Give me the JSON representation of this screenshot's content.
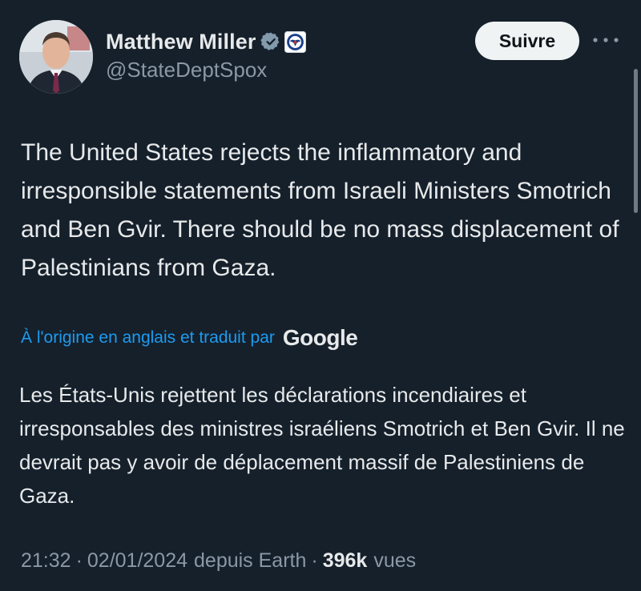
{
  "author": {
    "display_name": "Matthew Miller",
    "handle": "@StateDeptSpox",
    "verified_icon": "gray-verified-badge-icon",
    "affiliation_icon": "us-state-department-seal-icon"
  },
  "actions": {
    "follow_label": "Suivre",
    "more_icon": "more-options-icon"
  },
  "tweet": {
    "text": "The United States rejects the inflammatory and irresponsible statements from Israeli Ministers Smotrich and Ben Gvir. There should be no mass displacement of Palestinians from Gaza.",
    "translation_note": "À l'origine en anglais et traduit par",
    "translation_provider": "Google",
    "translated_text": "Les États-Unis rejettent les déclarations incendiaires et irresponsables des ministres israéliens Smotrich et Ben Gvir. Il ne devrait pas y avoir de déplacement massif de Palestiniens de Gaza."
  },
  "meta": {
    "time": "21:32",
    "separator": "·",
    "date": "02/01/2024",
    "source": "depuis Earth",
    "views_count": "396k",
    "views_label": "vues"
  },
  "colors": {
    "background": "#15202b",
    "primary_text": "#e7e9ea",
    "secondary_text": "#8b98a5",
    "link": "#1d9bf0",
    "verified_badge": "#829aab",
    "follow_button_bg": "#eff3f4"
  }
}
